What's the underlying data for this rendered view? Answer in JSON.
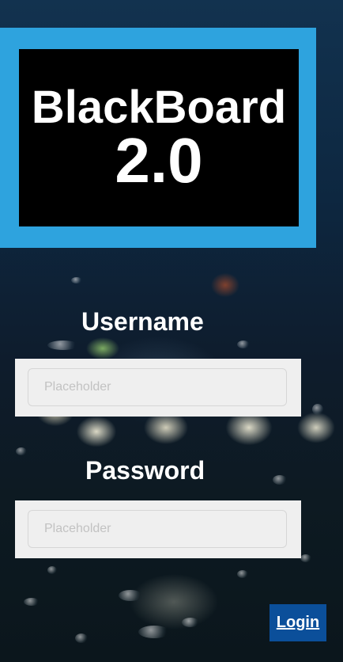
{
  "app": {
    "logo_line1": "BlackBoard",
    "logo_line2": "2.0"
  },
  "form": {
    "username_label": "Username",
    "username_placeholder": "Placeholder",
    "password_label": "Password",
    "password_placeholder": "Placeholder",
    "login_label": "Login"
  },
  "colors": {
    "header_accent": "#2ea3de",
    "logo_background": "#000000",
    "button": "#0b4f9a",
    "input_panel": "#efefef"
  }
}
